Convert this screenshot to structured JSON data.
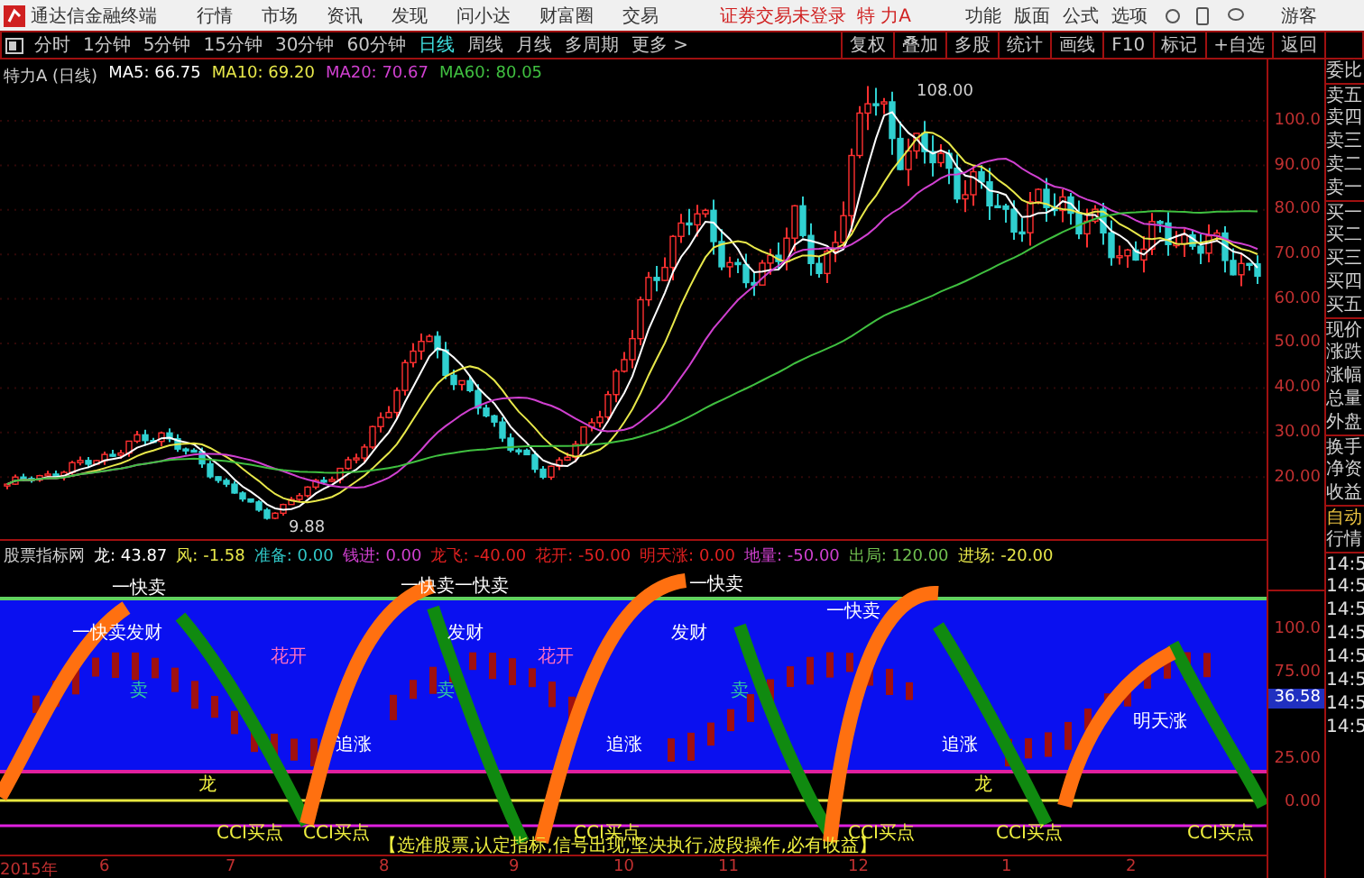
{
  "app_bar": {
    "title": "通达信金融终端",
    "menu": [
      "行情",
      "市场",
      "资讯",
      "发现",
      "问小达",
      "财富圈",
      "交易"
    ],
    "login_status": "证券交易未登录",
    "stock": "特 力A",
    "actions": [
      "功能",
      "版面",
      "公式",
      "选项"
    ],
    "user": "游客"
  },
  "period_tabs": [
    {
      "label": "分时",
      "selected": false
    },
    {
      "label": "1分钟",
      "selected": false
    },
    {
      "label": "5分钟",
      "selected": false
    },
    {
      "label": "15分钟",
      "selected": false
    },
    {
      "label": "30分钟",
      "selected": false
    },
    {
      "label": "60分钟",
      "selected": false
    },
    {
      "label": "日线",
      "selected": true
    },
    {
      "label": "周线",
      "selected": false
    },
    {
      "label": "月线",
      "selected": false
    },
    {
      "label": "多周期",
      "selected": false
    },
    {
      "label": "更多 >",
      "selected": false
    }
  ],
  "tools": [
    "复权",
    "叠加",
    "多股",
    "统计",
    "画线",
    "F10",
    "标记",
    "+自选",
    "返回"
  ],
  "main_chart": {
    "stock": "特力A",
    "period": "(日线)",
    "ma": [
      {
        "label": "MA5: 66.75",
        "color": "#ffffff"
      },
      {
        "label": "MA10: 69.20",
        "color": "#e8e84a"
      },
      {
        "label": "MA20: 70.67",
        "color": "#d040d0"
      },
      {
        "label": "MA60: 80.05",
        "color": "#40c040"
      }
    ],
    "high_label": "108.00",
    "low_label": "9.88",
    "axis": [
      "100.0",
      "90.00",
      "80.00",
      "70.00",
      "60.00",
      "50.00",
      "40.00",
      "30.00",
      "20.00"
    ]
  },
  "indicator": {
    "name": "股票指标网",
    "values": [
      {
        "label": "龙: 43.87",
        "color": "#ffffff"
      },
      {
        "label": "风: -1.58",
        "color": "#e8e84a"
      },
      {
        "label": "准备: 0.00",
        "color": "#30c8c8"
      },
      {
        "label": "钱进: 0.00",
        "color": "#d040d0"
      },
      {
        "label": "龙飞: -40.00",
        "color": "#e02020"
      },
      {
        "label": "花开: -50.00",
        "color": "#e02020"
      },
      {
        "label": "明天涨: 0.00",
        "color": "#e02020"
      },
      {
        "label": "地量: -50.00",
        "color": "#d040d0"
      },
      {
        "label": "出局: 120.00",
        "color": "#70c050"
      },
      {
        "label": "进场: -20.00",
        "color": "#e8e84a"
      }
    ],
    "signals": [
      {
        "text": "一快卖",
        "color": "#ffffff"
      },
      {
        "text": "一快卖发财",
        "color": "#ffffff"
      },
      {
        "text": "卖",
        "color": "#30c8a0"
      },
      {
        "text": "一快卖一快卖",
        "color": "#ffffff"
      },
      {
        "text": "发财",
        "color": "#ffffff"
      },
      {
        "text": "花开",
        "color": "#ff70c0"
      },
      {
        "text": "卖",
        "color": "#30c8a0"
      },
      {
        "text": "追涨",
        "color": "#ffffff"
      },
      {
        "text": "龙",
        "color": "#f0f040"
      },
      {
        "text": "花开",
        "color": "#ff70c0"
      },
      {
        "text": "一快卖",
        "color": "#ffffff"
      },
      {
        "text": "追涨",
        "color": "#ffffff"
      },
      {
        "text": "一快卖",
        "color": "#ffffff"
      },
      {
        "text": "发财",
        "color": "#ffffff"
      },
      {
        "text": "卖",
        "color": "#30c8a0"
      },
      {
        "text": "追涨",
        "color": "#ffffff"
      },
      {
        "text": "明天涨",
        "color": "#ffffff"
      },
      {
        "text": "龙",
        "color": "#f0f040"
      },
      {
        "text": "CCI买点",
        "color": "#f0f040"
      },
      {
        "text": "CCI买点",
        "color": "#f0f040"
      },
      {
        "text": "CCI买点",
        "color": "#f0f040"
      },
      {
        "text": "CCI买点",
        "color": "#f0f040"
      },
      {
        "text": "CCI买点",
        "color": "#f0f040"
      },
      {
        "text": "CCI买点",
        "color": "#f0f040"
      }
    ],
    "slogan": "【选准股票,认定指标,信号出现,坚决执行,波段操作,必有收益】",
    "axis": [
      "100.0",
      "75.00",
      "25.00",
      "0.00"
    ],
    "current": "36.58"
  },
  "dates": [
    "2015年",
    "6",
    "7",
    "8",
    "9",
    "10",
    "11",
    "12",
    "1",
    "2"
  ],
  "quote_panel": {
    "fields": [
      "委比",
      "卖五",
      "卖四",
      "卖三",
      "卖二",
      "卖一",
      "买一",
      "买二",
      "买三",
      "买四",
      "买五",
      "现价",
      "涨跌",
      "涨幅",
      "总量",
      "外盘",
      "换手",
      "净资",
      "收益"
    ],
    "auto": "自动",
    "market": "行情",
    "times": [
      "14:5",
      "14:5",
      "14:5",
      "14:5",
      "14:5",
      "14:5",
      "14:5",
      "14:5"
    ]
  }
}
